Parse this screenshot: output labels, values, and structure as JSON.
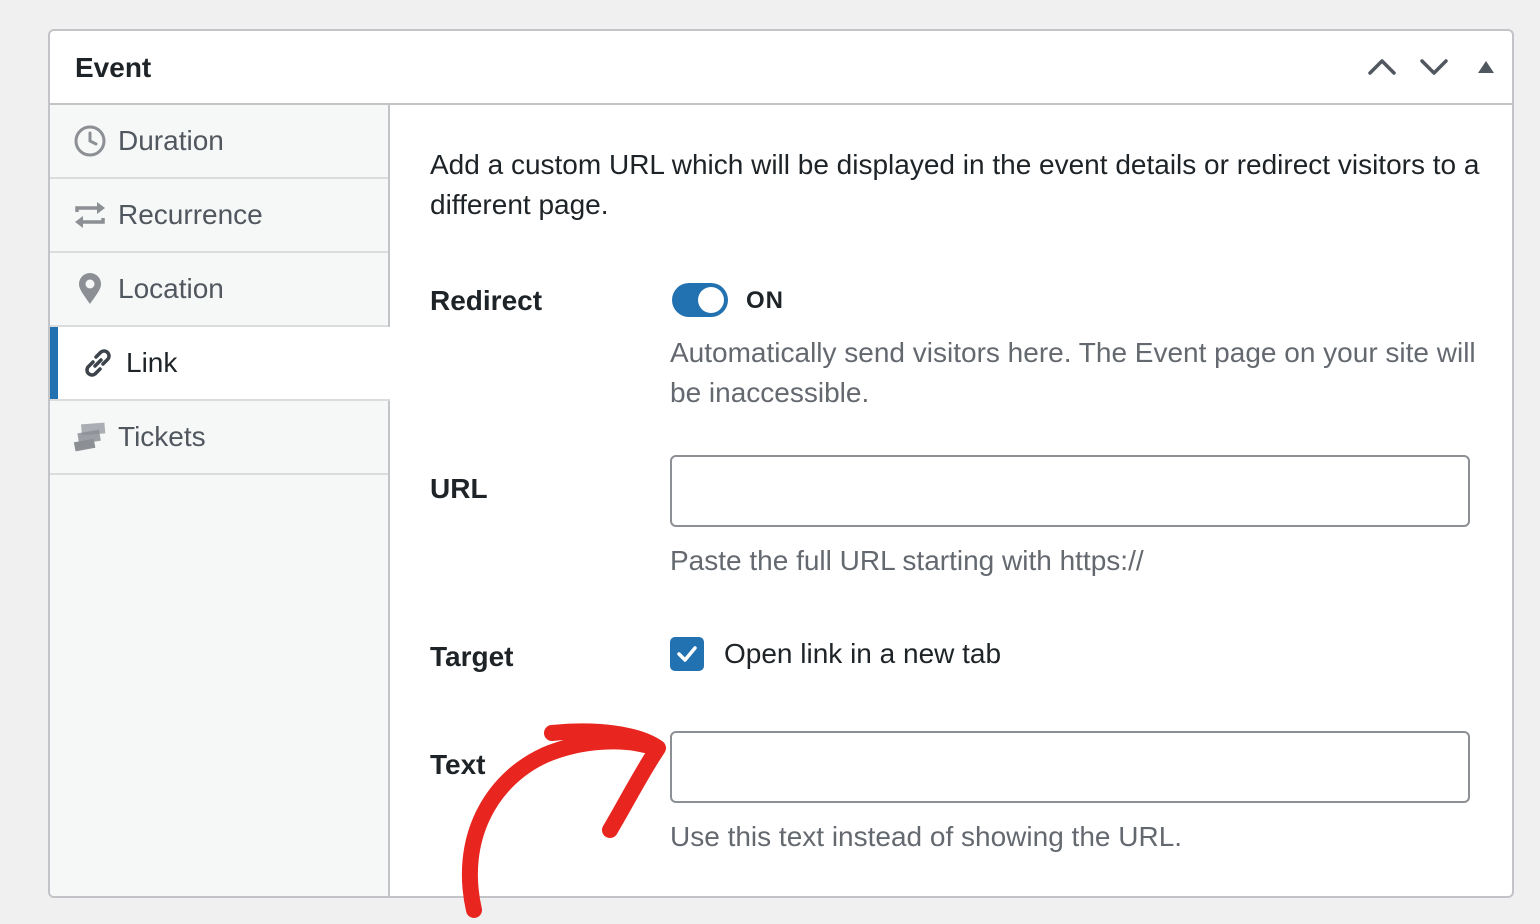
{
  "panel": {
    "title": "Event",
    "header_buttons": [
      "move-up",
      "move-down",
      "collapse"
    ]
  },
  "sidebar": {
    "items": [
      {
        "label": "Duration",
        "icon": "clock-icon",
        "active": false
      },
      {
        "label": "Recurrence",
        "icon": "repeat-icon",
        "active": false
      },
      {
        "label": "Location",
        "icon": "location-pin-icon",
        "active": false
      },
      {
        "label": "Link",
        "icon": "link-icon",
        "active": true
      },
      {
        "label": "Tickets",
        "icon": "tickets-icon",
        "active": false
      }
    ]
  },
  "main": {
    "intro": "Add a custom URL which will be displayed in the event details or redirect visitors to a different page.",
    "redirect": {
      "label": "Redirect",
      "toggle_state": "ON",
      "help": "Automatically send visitors here. The Event page on your site will be inaccessible."
    },
    "url": {
      "label": "URL",
      "value": "",
      "help": "Paste the full URL starting with https://"
    },
    "target": {
      "label": "Target",
      "checkbox_label": "Open link in a new tab",
      "checked": true
    },
    "text": {
      "label": "Text",
      "value": "",
      "help": "Use this text instead of showing the URL."
    }
  },
  "colors": {
    "accent": "#2271b1",
    "annotation_arrow": "#e8251f",
    "border": "#c3c4c7",
    "sidebar_bg": "#f6f7f7",
    "page_bg": "#f0f0f1"
  }
}
